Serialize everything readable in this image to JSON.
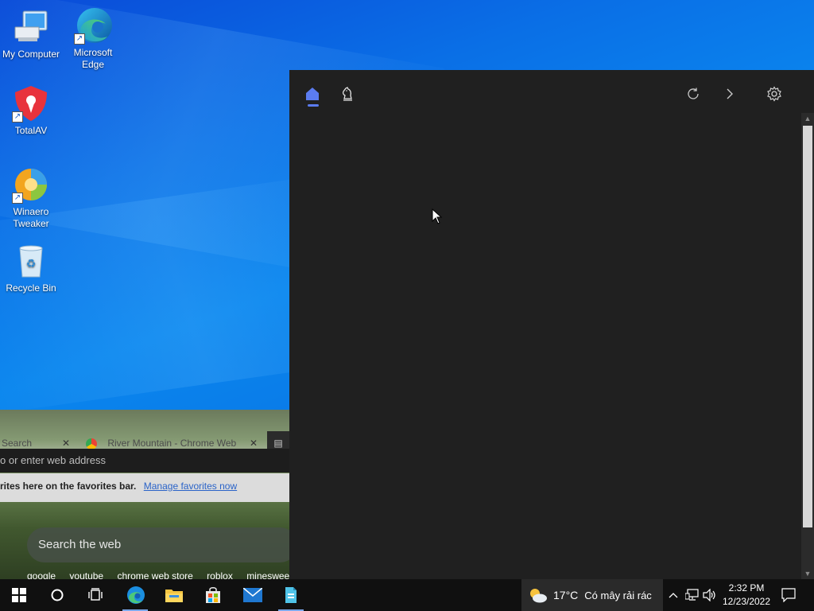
{
  "desktop": {
    "icons": [
      {
        "label": "My Computer"
      },
      {
        "label": "Microsoft Edge"
      },
      {
        "label": "TotalAV"
      },
      {
        "label": "Winaero Tweaker"
      },
      {
        "label": "Recycle Bin"
      }
    ]
  },
  "browser": {
    "tabs": [
      {
        "label": "Search"
      },
      {
        "label": "River Mountain - Chrome Web"
      }
    ],
    "address_placeholder": "o or enter web address",
    "favorites_text": "rites here on the favorites bar.",
    "manage_favorites": "Manage favorites now",
    "search_placeholder": "Search the web",
    "quick_links": [
      "google",
      "youtube",
      "chrome web store",
      "roblox",
      "minesweepe"
    ]
  },
  "panel": {
    "toolbar": {
      "home_icon": "home-icon",
      "chess_icon": "chess-knight-icon",
      "refresh_icon": "refresh-icon",
      "forward_icon": "chevron-right-icon",
      "settings_icon": "gear-icon"
    },
    "accent": "#5b7cf0",
    "background": "#202020"
  },
  "taskbar": {
    "weather": {
      "temp": "17°C",
      "desc": "Có mây rải rác"
    },
    "clock": {
      "time": "2:32 PM",
      "date": "12/23/2022"
    }
  }
}
